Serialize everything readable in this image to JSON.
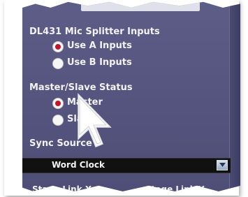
{
  "sections": {
    "splitter": {
      "title": "DL431 Mic Splitter Inputs",
      "options": [
        {
          "label": "Use A Inputs",
          "selected": true
        },
        {
          "label": "Use B Inputs",
          "selected": false
        }
      ]
    },
    "master_slave": {
      "title": "Master/Slave Status",
      "options": [
        {
          "label": "Master",
          "selected": true
        },
        {
          "label": "Slave",
          "selected": false
        }
      ]
    },
    "sync": {
      "title": "Sync Source",
      "dropdown_value": "Word Clock"
    },
    "stage_link": {
      "x_label": "Stage Link X",
      "y_label": "Stage Link Y"
    }
  },
  "colors": {
    "panel": "#55557f",
    "selected_radio": "#c0182a",
    "dropdown_bg": "#111111"
  },
  "icons": {
    "cursor": "hand-cursor-icon",
    "dropdown": "chevron-down-icon"
  }
}
